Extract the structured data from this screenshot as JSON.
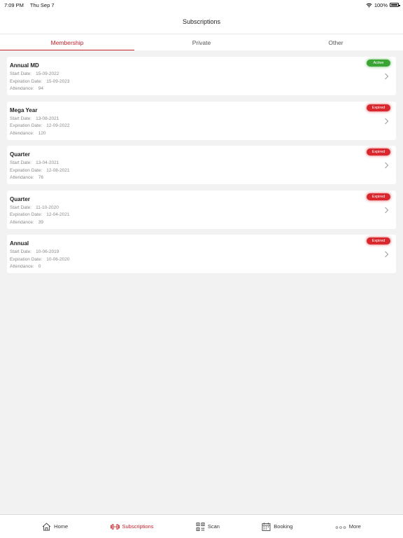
{
  "status": {
    "time": "7:09 PM",
    "date": "Thu Sep 7",
    "battery": "100%"
  },
  "header": {
    "title": "Subscriptions"
  },
  "tabs": [
    {
      "label": "Membership",
      "active": true
    },
    {
      "label": "Private",
      "active": false
    },
    {
      "label": "Other",
      "active": false
    }
  ],
  "labels": {
    "start": "Start Date:",
    "expiration": "Expiration Date:",
    "attendance": "Attendance:"
  },
  "subscriptions": [
    {
      "name": "Annual MD",
      "status": "Active",
      "start": "15-09-2022",
      "expiration": "15-09-2023",
      "attendance": "94"
    },
    {
      "name": "Mega Year",
      "status": "Expired",
      "start": "13-08-2021",
      "expiration": "12-09-2022",
      "attendance": "120"
    },
    {
      "name": "Quarter",
      "status": "Expired",
      "start": "13-04-2021",
      "expiration": "12-08-2021",
      "attendance": "76"
    },
    {
      "name": "Quarter",
      "status": "Expired",
      "start": "11-10-2020",
      "expiration": "12-04-2021",
      "attendance": "39"
    },
    {
      "name": "Annual",
      "status": "Expired",
      "start": "10-06-2019",
      "expiration": "10-06-2020",
      "attendance": "0"
    }
  ],
  "bottom_nav": [
    {
      "label": "Home",
      "icon": "home-icon"
    },
    {
      "label": "Subscriptions",
      "icon": "dumbbell-icon",
      "active": true
    },
    {
      "label": "Scan",
      "icon": "qr-code-icon"
    },
    {
      "label": "Booking",
      "icon": "calendar-icon"
    },
    {
      "label": "More",
      "icon": "more-icon"
    }
  ],
  "colors": {
    "accent": "#c8202a",
    "active": "#3aa535",
    "expired": "#d9272e"
  }
}
